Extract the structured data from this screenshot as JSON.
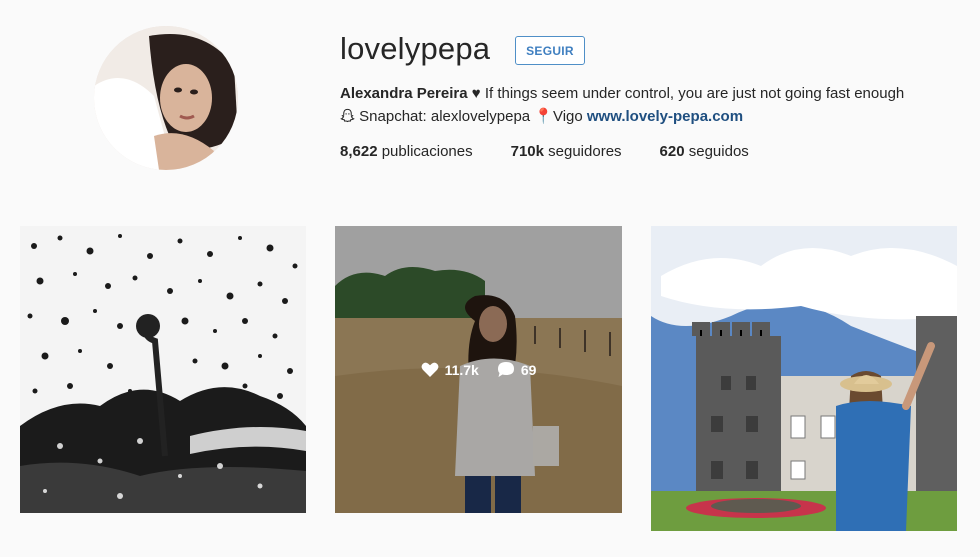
{
  "profile": {
    "username": "lovelypepa",
    "follow_label": "SEGUIR",
    "full_name": "Alexandra Pereira",
    "bio_line1_rest": "♥ If things seem under control, you are just not going fast enough",
    "bio_line2_text": " Snapchat: alexlovelypepa 📍Vigo ",
    "website": "www.lovely-pepa.com"
  },
  "stats": {
    "posts_count": "8,622",
    "posts_label": " publicaciones",
    "followers_count": "710k",
    "followers_label": " seguidores",
    "following_count": "620",
    "following_label": " seguidos"
  },
  "posts": [
    {
      "icon": "rain-window-photo"
    },
    {
      "icon": "beach-portrait-photo",
      "likes": "11.7k",
      "comments": "69"
    },
    {
      "icon": "castle-photo"
    }
  ],
  "colors": {
    "accent": "#3f7fc0",
    "link": "#1f4f80",
    "background": "#fafafa"
  }
}
